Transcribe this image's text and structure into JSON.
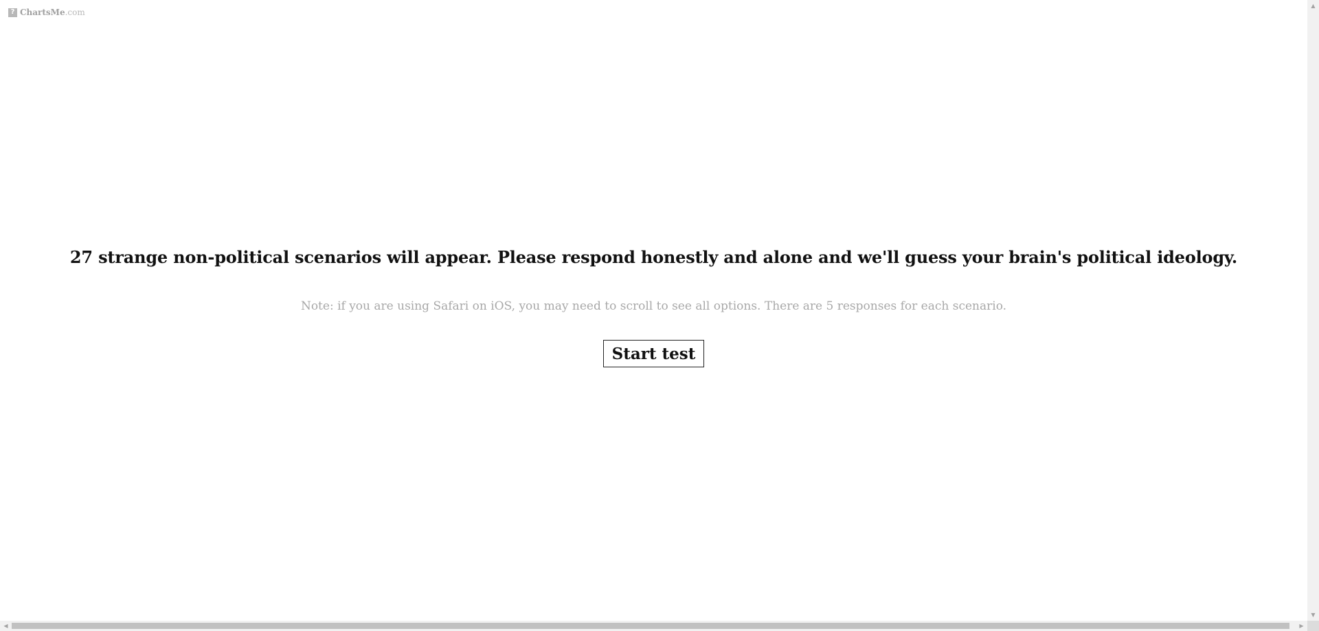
{
  "brand": {
    "icon": "question-icon",
    "icon_glyph": "?",
    "name": "ChartsMe",
    "tld": ".com"
  },
  "main": {
    "intro": "27 strange non-political scenarios will appear. Please respond honestly and alone and we'll guess your brain's political ideology.",
    "note": "Note: if you are using Safari on iOS, you may need to scroll to see all options. There are 5 responses for each scenario.",
    "start_label": "Start test"
  },
  "scrollbars": {
    "up_glyph": "▲",
    "down_glyph": "▼",
    "left_glyph": "◀",
    "right_glyph": "▶"
  },
  "colors": {
    "text": "#111111",
    "muted": "#a8a8a8",
    "background": "#ffffff"
  }
}
